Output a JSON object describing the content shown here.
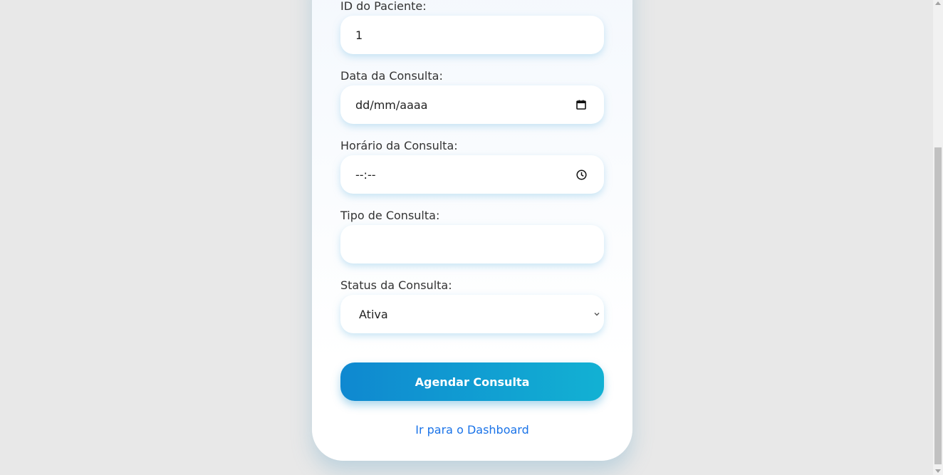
{
  "form": {
    "patient_id": {
      "label": "ID do Paciente:",
      "value": "1"
    },
    "date": {
      "label": "Data da Consulta:",
      "value": "dd/mm/aaaa",
      "icon": "calendar-icon"
    },
    "time": {
      "label": "Horário da Consulta:",
      "value": "--:--",
      "icon": "clock-icon"
    },
    "type": {
      "label": "Tipo de Consulta:",
      "value": ""
    },
    "status": {
      "label": "Status da Consulta:",
      "value": "Ativa",
      "icon": "chevron-down-icon"
    },
    "submit_label": "Agendar Consulta",
    "dashboard_link": "Ir para o Dashboard"
  },
  "colors": {
    "background": "#e8e8e8",
    "accent_start": "#0f88d0",
    "accent_end": "#12b1d3",
    "link": "#1a73e8"
  }
}
